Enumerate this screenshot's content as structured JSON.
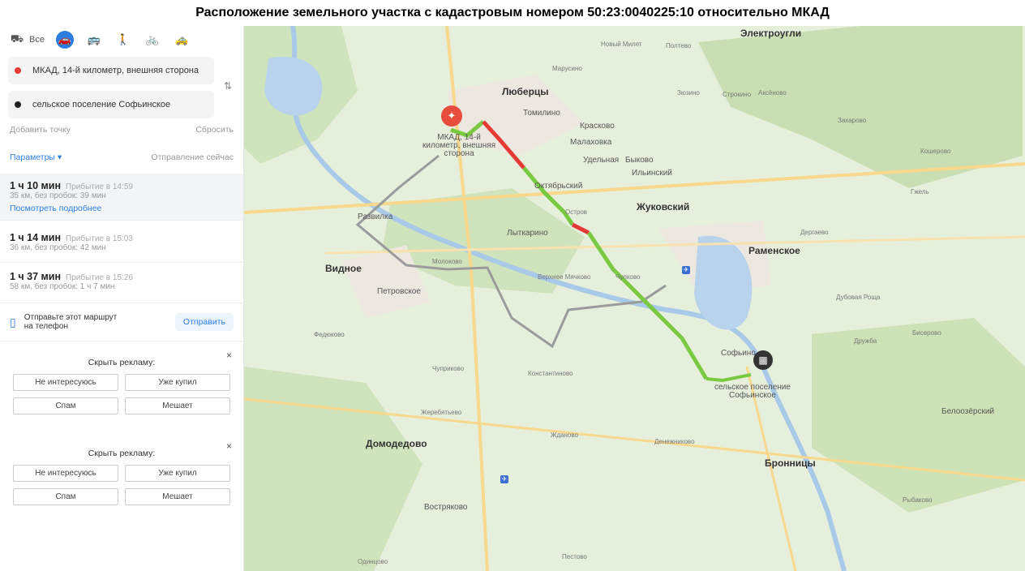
{
  "title": "Расположение земельного участка с кадастровым номером 50:23:0040225:10 относительно МКАД",
  "panel": {
    "modes": [
      {
        "icon": "car-transit-icon",
        "label": "Все"
      },
      {
        "icon": "car-icon",
        "label": ""
      },
      {
        "icon": "bus-icon",
        "label": ""
      },
      {
        "icon": "pedestrian-icon",
        "label": ""
      },
      {
        "icon": "bicycle-icon",
        "label": ""
      },
      {
        "icon": "taxi-icon",
        "label": ""
      }
    ],
    "point_a": "МКАД, 14-й километр, внешняя сторона",
    "point_b": "сельское поселение Софьинское",
    "add_point": "Добавить точку",
    "reset": "Сбросить",
    "params": "Параметры ▾",
    "departure": "Отправление сейчас",
    "routes": [
      {
        "time": "1 ч 10 мин",
        "arrival": "Прибытие в 14:59",
        "details": "35 км, без пробок: 39 мин",
        "more": "Посмотреть подробнее"
      },
      {
        "time": "1 ч 14 мин",
        "arrival": "Прибытие в 15:03",
        "details": "36 км, без пробок: 42 мин"
      },
      {
        "time": "1 ч 37 мин",
        "arrival": "Прибытие в 15:26",
        "details": "58 км, без пробок: 1 ч 7 мин"
      }
    ],
    "send_text_1": "Отправьте этот маршрут",
    "send_text_2": "на телефон",
    "send_button": "Отправить",
    "ads": [
      {
        "title": "Скрыть рекламу:",
        "close": "×",
        "options": [
          "Не интересуюсь",
          "Уже купил",
          "Спам",
          "Мешает"
        ]
      },
      {
        "title": "Скрыть рекламу:",
        "close": "×",
        "options": [
          "Не интересуюсь",
          "Уже купил",
          "Спам",
          "Мешает"
        ]
      }
    ]
  },
  "map": {
    "colors": {
      "fast": "#7ac943",
      "slow": "#f5b700",
      "jam": "#e53935",
      "alt": "#9b9b9b",
      "water": "#a9c9e8",
      "forest": "#c6deb0",
      "road": "#f7d88c"
    },
    "pin_a_label": [
      "МКАД, 14-й",
      "километр, внешняя",
      "сторона"
    ],
    "pin_b_label": [
      "сельское поселение",
      "Софьинское"
    ],
    "labels": [
      {
        "text": "Электроугли",
        "cls": "city"
      },
      {
        "text": "Новый Милет",
        "cls": "small"
      },
      {
        "text": "Полтево",
        "cls": "small"
      },
      {
        "text": "Марусино",
        "cls": "small"
      },
      {
        "text": "Люберцы",
        "cls": "city"
      },
      {
        "text": "Зюзино",
        "cls": "small"
      },
      {
        "text": "Строкино",
        "cls": "small"
      },
      {
        "text": "Аксёново",
        "cls": "small"
      },
      {
        "text": "Томилино",
        "cls": ""
      },
      {
        "text": "Красково",
        "cls": ""
      },
      {
        "text": "Малаховка",
        "cls": ""
      },
      {
        "text": "Удельная",
        "cls": ""
      },
      {
        "text": "Быково",
        "cls": ""
      },
      {
        "text": "Ильинский",
        "cls": ""
      },
      {
        "text": "Октябрьский",
        "cls": ""
      },
      {
        "text": "Жуковский",
        "cls": "city"
      },
      {
        "text": "Лыткарино",
        "cls": ""
      },
      {
        "text": "Раменское",
        "cls": "city"
      },
      {
        "text": "Развилка",
        "cls": ""
      },
      {
        "text": "Видное",
        "cls": "city"
      },
      {
        "text": "Петровское",
        "cls": ""
      },
      {
        "text": "Молоково",
        "cls": "small"
      },
      {
        "text": "Верхнее Мячково",
        "cls": "small"
      },
      {
        "text": "Остров",
        "cls": "small"
      },
      {
        "text": "Чулково",
        "cls": "small"
      },
      {
        "text": "Софьино",
        "cls": ""
      },
      {
        "text": "Домодедово",
        "cls": "city"
      },
      {
        "text": "Востряково",
        "cls": ""
      },
      {
        "text": "Бронницы",
        "cls": "city"
      },
      {
        "text": "Белоозёрский",
        "cls": ""
      },
      {
        "text": "Захарово",
        "cls": "small"
      },
      {
        "text": "Кошерово",
        "cls": "small"
      },
      {
        "text": "Дергаево",
        "cls": "small"
      },
      {
        "text": "Константиново",
        "cls": "small"
      },
      {
        "text": "Жеребятьево",
        "cls": "small"
      },
      {
        "text": "Жданово",
        "cls": "small"
      },
      {
        "text": "Денежниково",
        "cls": "small"
      },
      {
        "text": "Чуприково",
        "cls": "small"
      },
      {
        "text": "Федюково",
        "cls": "small"
      },
      {
        "text": "Дубовая Роща",
        "cls": "small"
      },
      {
        "text": "Дружба",
        "cls": "small"
      },
      {
        "text": "Бисерово",
        "cls": "small"
      },
      {
        "text": "Рыбаково",
        "cls": "small"
      },
      {
        "text": "Пестово",
        "cls": "small"
      },
      {
        "text": "Одинцово",
        "cls": "small"
      },
      {
        "text": "Гжель",
        "cls": "small"
      }
    ]
  }
}
